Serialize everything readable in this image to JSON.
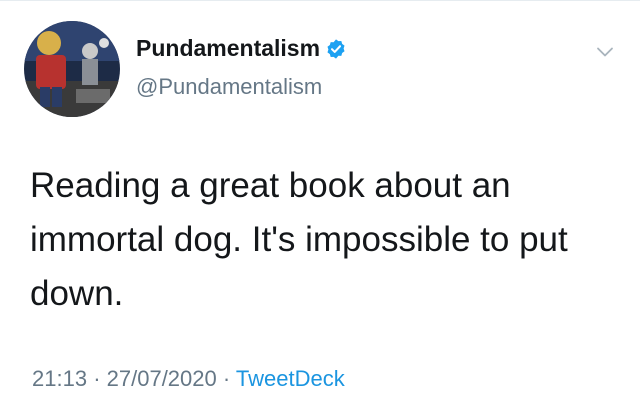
{
  "author": {
    "display_name": "Pundamentalism",
    "handle": "@Pundamentalism",
    "verified": true
  },
  "tweet": {
    "text": "Reading a great book about an immortal dog. It's impossible to put down.",
    "time": "21:13",
    "separator": "·",
    "date": "27/07/2020",
    "source": "TweetDeck"
  },
  "icons": {
    "verified": "verified-badge-icon",
    "menu": "chevron-down-icon"
  },
  "colors": {
    "text": "#14171a",
    "secondary": "#657786",
    "link": "#1b95e0",
    "verified": "#1da1f2"
  }
}
